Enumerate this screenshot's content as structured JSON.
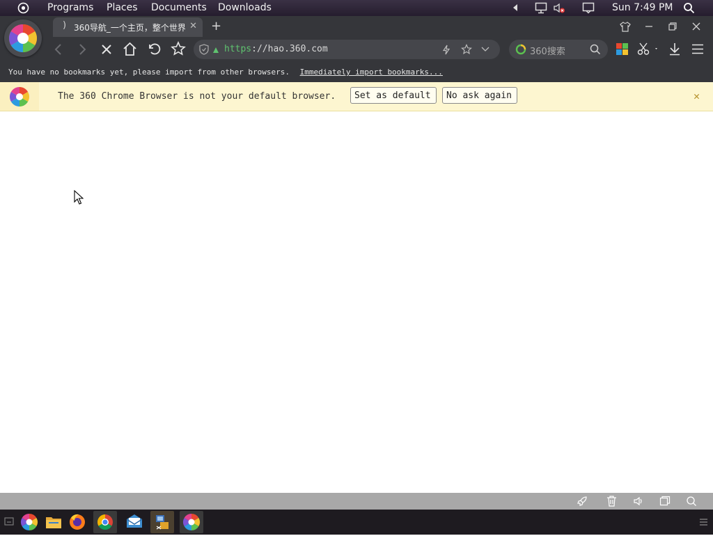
{
  "top_panel": {
    "menus": [
      "Programs",
      "Places",
      "Documents",
      "Downloads"
    ],
    "clock": "Sun 7:49 PM"
  },
  "browser": {
    "tab_title": "360导航_一个主页，整个世界",
    "url_scheme": "https",
    "url_rest": "://hao.360.com",
    "search_placeholder": "360搜索",
    "bookmark_message": "You have no bookmarks yet, please import from other browsers.",
    "bookmark_link": "Immediately import bookmarks..."
  },
  "notification": {
    "message": "The 360 Chrome Browser is not your default browser.",
    "set_default": "Set as default",
    "no_ask": "No ask again"
  },
  "icons": {
    "top_panel": [
      "app-menu-icon",
      "arrow-left-icon",
      "network-icon",
      "volume-muted-icon",
      "display-icon",
      "search-icon"
    ],
    "toolbar": [
      "back-icon",
      "forward-icon",
      "stop-icon",
      "home-icon",
      "undo-icon",
      "star-icon",
      "shield-icon",
      "lightning-icon",
      "favorite-icon",
      "chevron-down-icon",
      "search-icon",
      "apps-grid-icon",
      "scissors-icon",
      "download-icon",
      "menu-icon"
    ],
    "statusbar": [
      "rocket-icon",
      "trash-icon",
      "volume-icon",
      "window-icon",
      "zoom-icon"
    ],
    "taskbar": [
      "show-desktop-icon",
      "360-browser-icon",
      "files-icon",
      "firefox-icon",
      "chrome-icon",
      "mail-icon",
      "system-tool-icon",
      "360-browser-icon",
      "taskbar-menu-icon"
    ]
  },
  "colors": {
    "chrome_bg": "#35363a",
    "notify_bg": "#fdf6d0",
    "url_scheme": "#5fc26f"
  }
}
